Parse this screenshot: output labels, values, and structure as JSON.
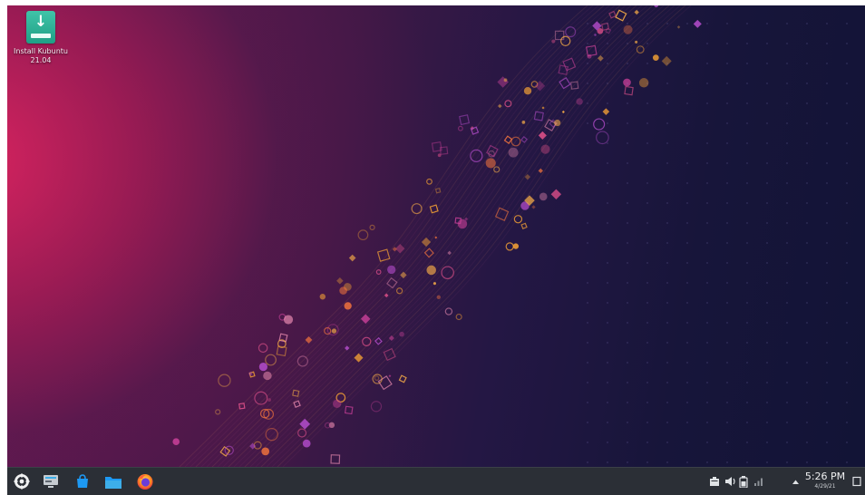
{
  "desktop": {
    "icons": [
      {
        "label_line1": "Install Kubuntu",
        "label_line2": "21.04",
        "icon": "install-download-icon"
      }
    ]
  },
  "taskbar": {
    "launchers": [
      {
        "name": "application-launcher",
        "icon": "kubuntu-logo-icon"
      },
      {
        "name": "system-settings",
        "icon": "settings-panel-icon"
      },
      {
        "name": "discover",
        "icon": "discover-store-icon"
      },
      {
        "name": "dolphin",
        "icon": "folder-icon"
      },
      {
        "name": "firefox",
        "icon": "firefox-icon"
      }
    ],
    "tray": {
      "icons": [
        "clipboard-icon",
        "volume-icon",
        "battery-icon",
        "network-icon",
        "expand-arrow-icon",
        "show-desktop-icon"
      ],
      "time": "5:26 PM",
      "date": "4/29/21"
    }
  },
  "colors": {
    "panel": "#2b2f36",
    "accent": "#3daee9",
    "icon_teal": "#2db59a"
  }
}
